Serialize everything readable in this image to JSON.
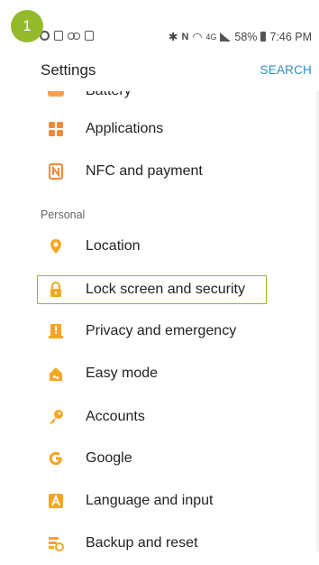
{
  "step_badge": "1",
  "status_bar": {
    "battery": "58%",
    "time": "7:46 PM",
    "network": "4G"
  },
  "header": {
    "title": "Settings",
    "search_label": "SEARCH"
  },
  "list": {
    "truncated_item": "Battery",
    "items_top": [
      {
        "label": "Applications",
        "icon": "apps-grid-icon",
        "color": "#f08a3a"
      },
      {
        "label": "NFC and payment",
        "icon": "nfc-icon",
        "color": "#f08a3a"
      }
    ],
    "section_personal": "Personal",
    "items_personal": [
      {
        "label": "Location",
        "icon": "location-pin-icon",
        "color": "#f5a623"
      },
      {
        "label": "Lock screen and security",
        "icon": "lock-icon",
        "color": "#f5a623",
        "highlighted": true
      },
      {
        "label": "Privacy and emergency",
        "icon": "privacy-alert-icon",
        "color": "#f5a623"
      },
      {
        "label": "Easy mode",
        "icon": "easy-mode-icon",
        "color": "#f5a623"
      },
      {
        "label": "Accounts",
        "icon": "key-icon",
        "color": "#f5a623"
      },
      {
        "label": "Google",
        "icon": "google-g-icon",
        "color": "#f5a623"
      },
      {
        "label": "Language and input",
        "icon": "language-a-icon",
        "color": "#f5a623"
      },
      {
        "label": "Backup and reset",
        "icon": "backup-icon",
        "color": "#f5a623"
      }
    ]
  },
  "colors": {
    "accent": "#2a8ec4",
    "highlight": "#94ba2b",
    "icon_orange": "#f5a623"
  }
}
